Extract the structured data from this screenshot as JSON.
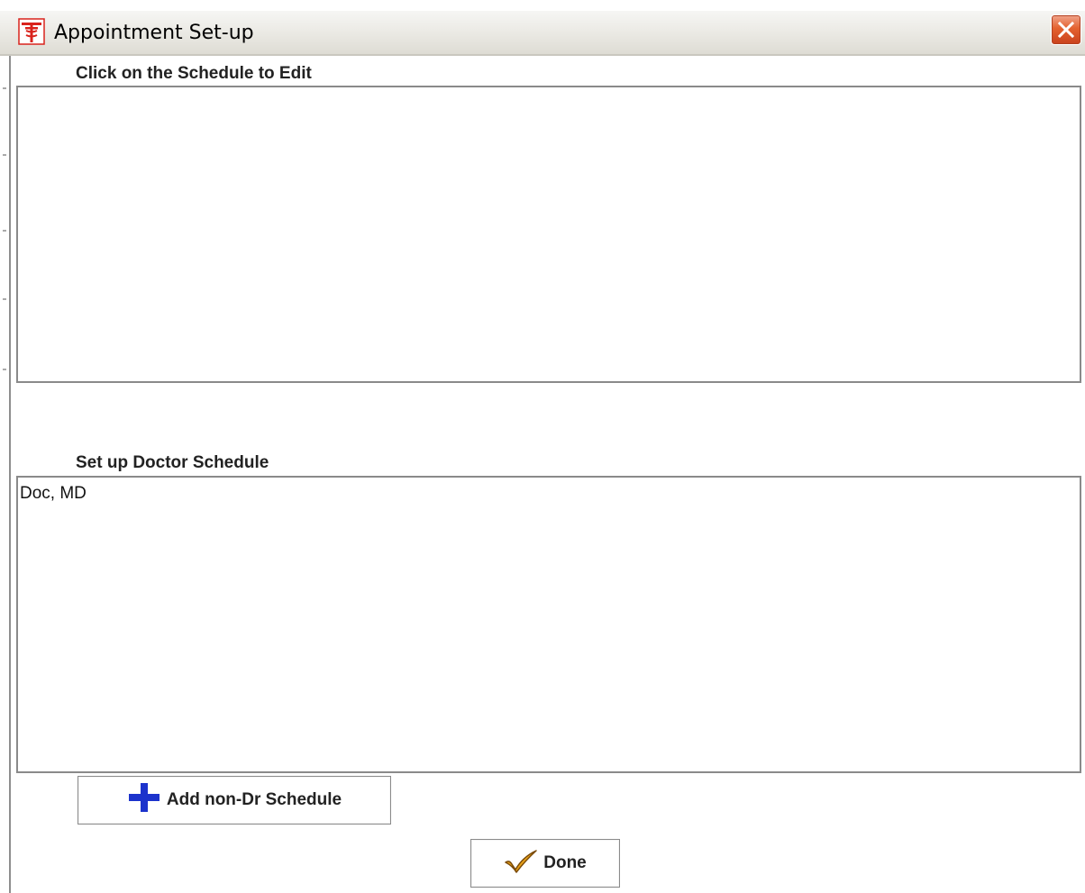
{
  "window": {
    "title": "Appointment Set-up",
    "icons": {
      "app": "caduceus-logo-icon",
      "close": "close-icon"
    },
    "colors": {
      "close_button": "#e4622f",
      "app_icon": "#d9231c"
    }
  },
  "schedules_section": {
    "label": "Click on the Schedule to Edit",
    "items": []
  },
  "doctor_section": {
    "label": "Set up Doctor Schedule",
    "items": [
      "Doc, MD"
    ]
  },
  "buttons": {
    "add_non_dr": {
      "label": "Add non-Dr Schedule",
      "icon": "plus-icon",
      "icon_color": "#1c33cc"
    },
    "done": {
      "label": "Done",
      "icon": "checkmark-icon",
      "icon_color": "#e8a21a"
    }
  }
}
